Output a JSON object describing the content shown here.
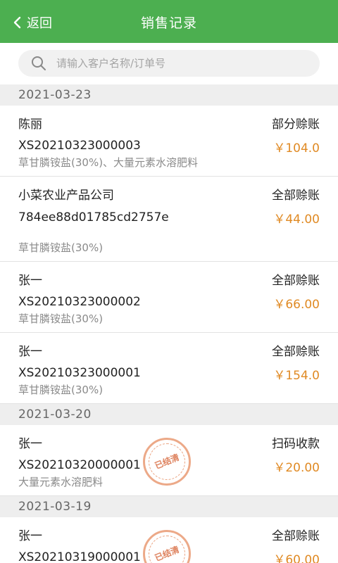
{
  "header": {
    "back_label": "返回",
    "title": "销售记录",
    "bg": "#4caf50"
  },
  "search": {
    "placeholder": "请输入客户名称/订单号"
  },
  "colors": {
    "amount": "#e08a24",
    "stamp": "#e27846"
  },
  "groups": [
    {
      "date": "2021-03-23",
      "rows": [
        {
          "customer": "陈丽",
          "status": "部分赊账",
          "order": "XS20210323000003",
          "amount": "￥104.0",
          "product": "草甘膦铵盐(30%)、大量元素水溶肥料"
        },
        {
          "customer": "小菜农业产品公司",
          "status": "全部赊账",
          "order": "784ee88d01785cd2757e",
          "amount": "￥44.00",
          "product": "草甘膦铵盐(30%)"
        },
        {
          "customer": "张一",
          "status": "全部赊账",
          "order": "XS20210323000002",
          "amount": "￥66.00",
          "product": "草甘膦铵盐(30%)"
        },
        {
          "customer": "张一",
          "status": "全部赊账",
          "order": "XS20210323000001",
          "amount": "￥154.0",
          "product": "草甘膦铵盐(30%)"
        }
      ]
    },
    {
      "date": "2021-03-20",
      "rows": [
        {
          "customer": "张一",
          "status": "扫码收款",
          "order": "XS20210320000001",
          "amount": "￥20.00",
          "product": "大量元素水溶肥料",
          "stamp": "已结清"
        }
      ]
    },
    {
      "date": "2021-03-19",
      "rows": [
        {
          "customer": "张一",
          "status": "全部赊账",
          "order": "XS20210319000001",
          "amount": "￥60.00",
          "stamp": "已结清"
        }
      ]
    }
  ]
}
